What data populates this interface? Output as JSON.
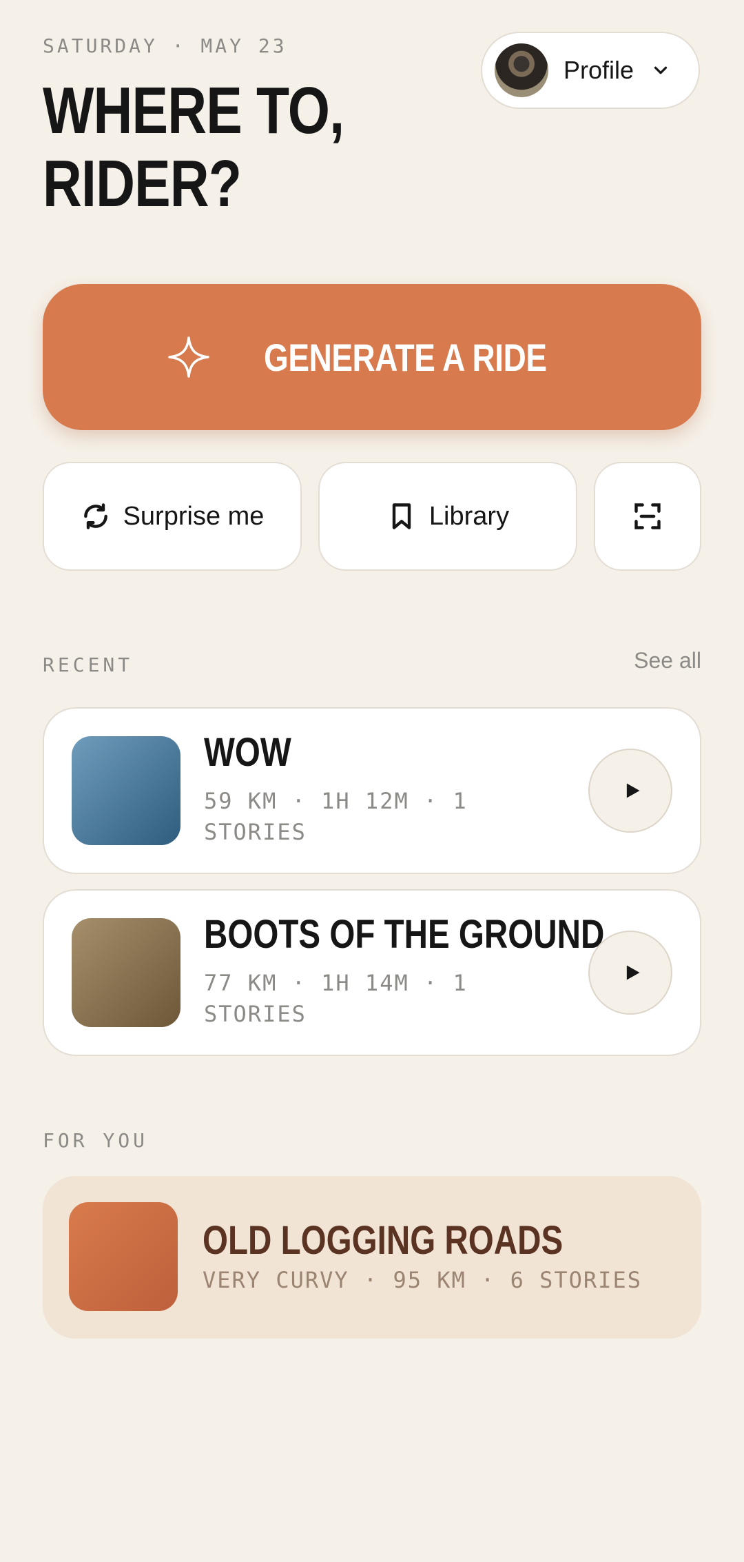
{
  "header": {
    "date": "SATURDAY · MAY 23",
    "headline_line1": "WHERE TO,",
    "headline_line2": "RIDER?"
  },
  "profile": {
    "label": "Profile",
    "icon": "chevron-down-icon"
  },
  "primary_action": {
    "label": "GENERATE A RIDE",
    "icon": "sparkle-icon",
    "color": "#d77b4f"
  },
  "quick_actions": [
    {
      "label": "Surprise me",
      "icon": "refresh-icon"
    },
    {
      "label": "Library",
      "icon": "bookmark-icon"
    },
    {
      "label": "",
      "icon": "scan-icon"
    }
  ],
  "recent": {
    "section_label": "RECENT",
    "see_all": "See all",
    "items": [
      {
        "title": "WOW",
        "meta": "59 KM · 1H 12M · 1 STORIES",
        "thumb_color": "#4f7fa0"
      },
      {
        "title": "BOOTS OF THE GROUND",
        "meta": "77 KM · 1H 14M · 1 STORIES",
        "thumb_color": "#8b7350"
      }
    ]
  },
  "for_you": {
    "section_label": "FOR YOU",
    "item": {
      "title": "OLD LOGGING ROADS",
      "meta": "VERY CURVY · 95 KM · 6 STORIES",
      "thumb_color": "#d07348"
    }
  }
}
